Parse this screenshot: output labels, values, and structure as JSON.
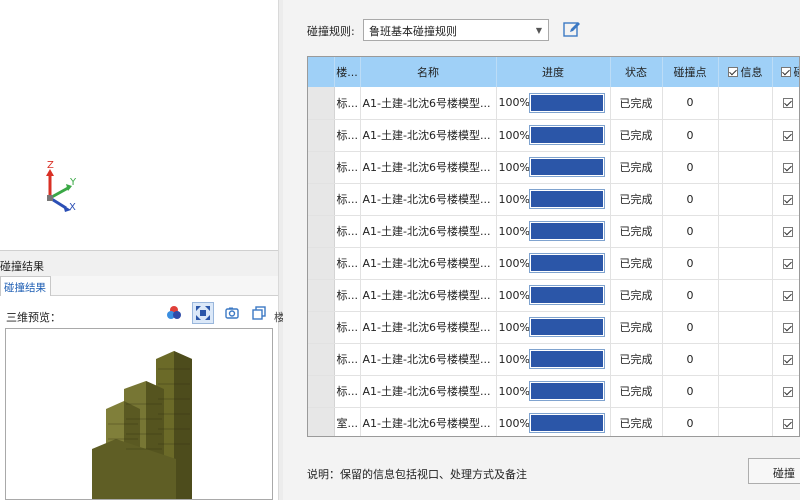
{
  "axis": {
    "z": "Z",
    "y": "Y",
    "x": "X"
  },
  "results_panel": {
    "title": "碰撞结果",
    "tab": "碰撞结果",
    "preview_label": "三维预览：",
    "extra_label": "楼"
  },
  "toolbar_icons": [
    "color-balls-icon",
    "fit-view-icon",
    "camera-icon",
    "window-copy-icon"
  ],
  "rule": {
    "label": "碰撞规则:",
    "value": "鲁班基本碰撞规则"
  },
  "table": {
    "headers": {
      "floor": "楼...",
      "name": "名称",
      "progress": "进度",
      "status": "状态",
      "points": "碰撞点",
      "info": "信息",
      "collision": "碰撞"
    },
    "rows": [
      {
        "floor": "标...",
        "name": "A1-土建-北沈6号楼模型...",
        "progress": "100%",
        "status": "已完成",
        "points": "0"
      },
      {
        "floor": "标...",
        "name": "A1-土建-北沈6号楼模型...",
        "progress": "100%",
        "status": "已完成",
        "points": "0"
      },
      {
        "floor": "标...",
        "name": "A1-土建-北沈6号楼模型...",
        "progress": "100%",
        "status": "已完成",
        "points": "0"
      },
      {
        "floor": "标...",
        "name": "A1-土建-北沈6号楼模型...",
        "progress": "100%",
        "status": "已完成",
        "points": "0"
      },
      {
        "floor": "标...",
        "name": "A1-土建-北沈6号楼模型...",
        "progress": "100%",
        "status": "已完成",
        "points": "0"
      },
      {
        "floor": "标...",
        "name": "A1-土建-北沈6号楼模型...",
        "progress": "100%",
        "status": "已完成",
        "points": "0"
      },
      {
        "floor": "标...",
        "name": "A1-土建-北沈6号楼模型...",
        "progress": "100%",
        "status": "已完成",
        "points": "0"
      },
      {
        "floor": "标...",
        "name": "A1-土建-北沈6号楼模型...",
        "progress": "100%",
        "status": "已完成",
        "points": "0"
      },
      {
        "floor": "标...",
        "name": "A1-土建-北沈6号楼模型...",
        "progress": "100%",
        "status": "已完成",
        "points": "0"
      },
      {
        "floor": "标...",
        "name": "A1-土建-北沈6号楼模型...",
        "progress": "100%",
        "status": "已完成",
        "points": "0"
      },
      {
        "floor": "室...",
        "name": "A1-土建-北沈6号楼模型...",
        "progress": "100%",
        "status": "已完成",
        "points": "0"
      }
    ]
  },
  "note": "说明：保留的信息包括视口、处理方式及备注",
  "confirm_button": "碰撞",
  "colors": {
    "header_bg": "#9fd0f7",
    "progress_fill": "#2b56a8"
  }
}
